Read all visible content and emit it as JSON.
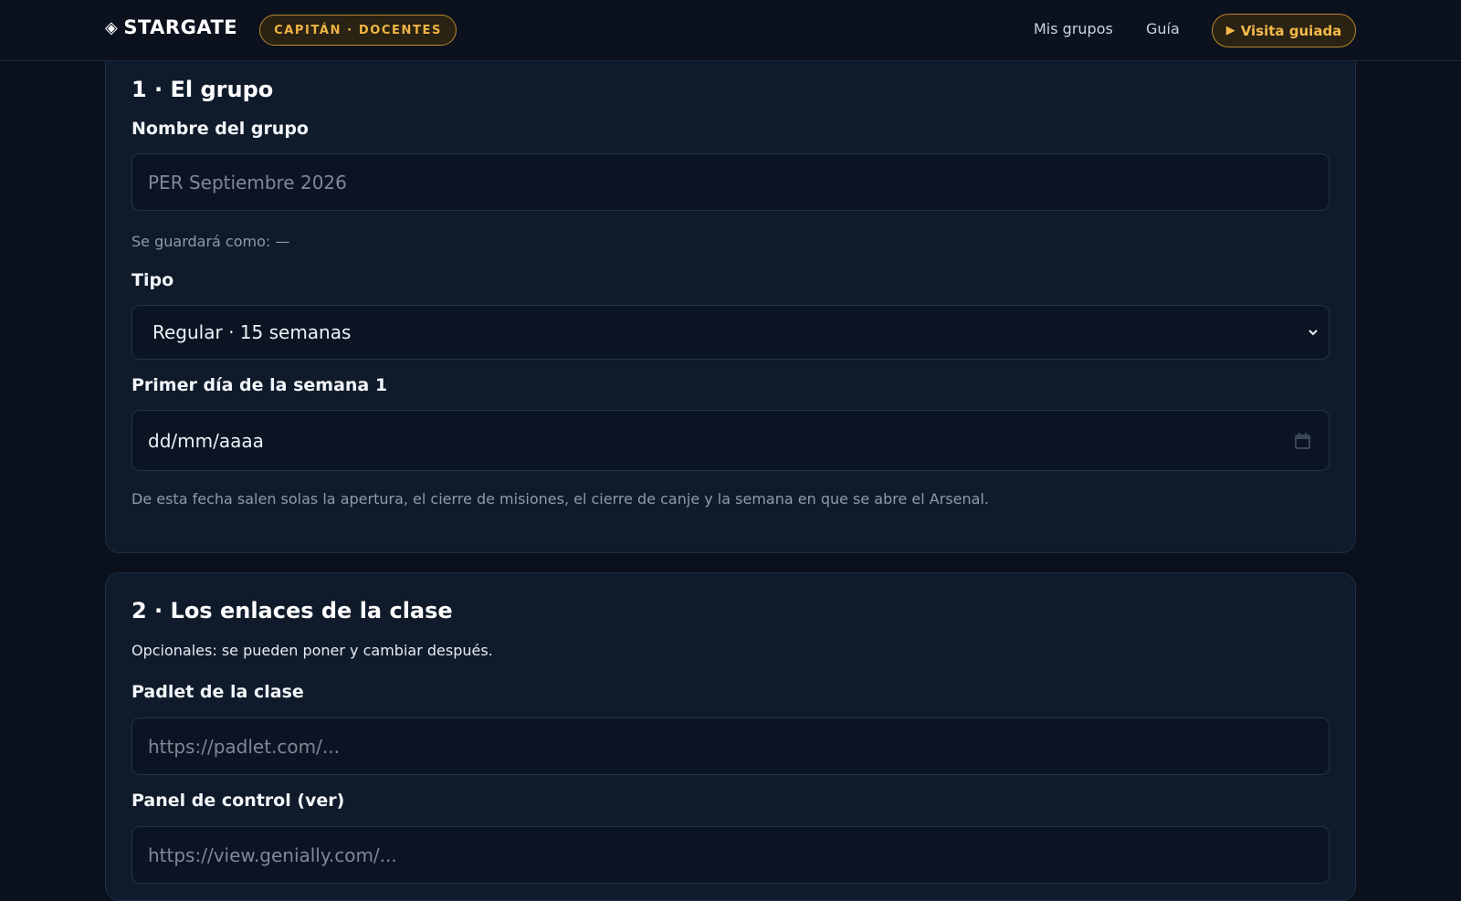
{
  "header": {
    "brand": "STARGATE",
    "role_badge": "CAPITÁN · DOCENTES",
    "nav": {
      "grupos": "Mis grupos",
      "guia": "Guía"
    },
    "tour_button": "Visita guiada",
    "icons": {
      "brand": "diamond-icon",
      "tour": "play-icon"
    }
  },
  "section1": {
    "title": "1 · El grupo",
    "name_label": "Nombre del grupo",
    "name_placeholder": "PER Septiembre 2026",
    "saved_as": "Se guardará como: —",
    "type_label": "Tipo",
    "type_selected": "Regular · 15 semanas",
    "date_label": "Primer día de la semana 1",
    "date_placeholder": "dd/mm/aaaa",
    "date_hint": "De esta fecha salen solas la apertura, el cierre de misiones, el cierre de canje y la semana en que se abre el Arsenal."
  },
  "section2": {
    "title": "2 · Los enlaces de la clase",
    "subtitle": "Opcionales: se pueden poner y cambiar después.",
    "padlet_label": "Padlet de la clase",
    "padlet_placeholder": "https://padlet.com/...",
    "panel_label": "Panel de control (ver)",
    "panel_placeholder": "https://view.genially.com/..."
  },
  "colors": {
    "accent": "#f0b444",
    "background": "#0a111c",
    "card": "#0f1b2b"
  }
}
